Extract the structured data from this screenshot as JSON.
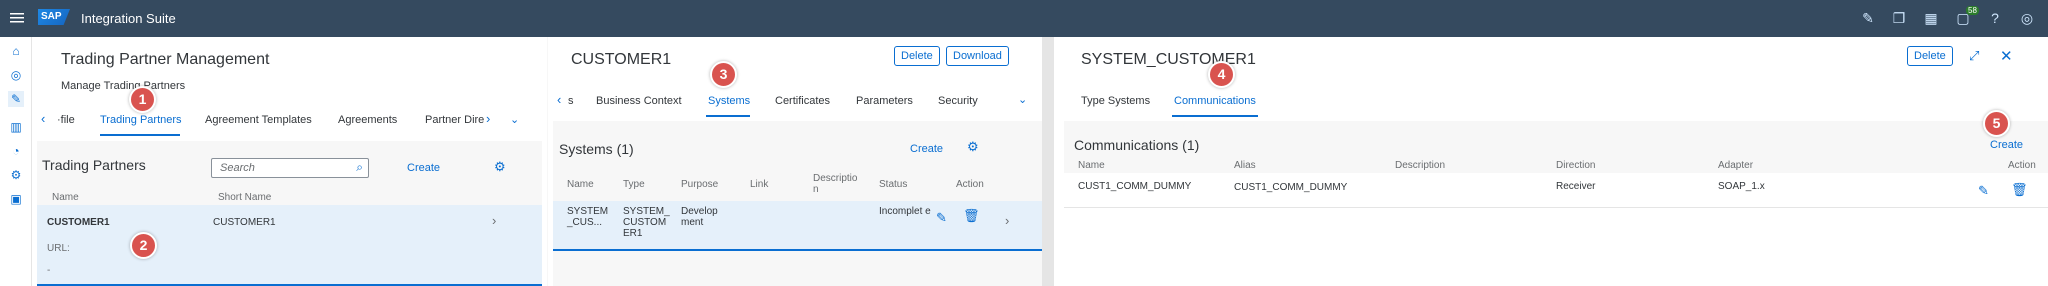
{
  "shell": {
    "logo": "SAP",
    "title": "Integration Suite",
    "notification_count": "58"
  },
  "col1": {
    "title": "Trading Partner Management",
    "subtitle": "Manage Trading Partners",
    "tabs": [
      "·file",
      "Trading Partners",
      "Agreement Templates",
      "Agreements",
      "Partner Dire"
    ],
    "panel_title": "Trading Partners",
    "search_placeholder": "Search",
    "create": "Create",
    "headers": [
      "Name",
      "Short Name"
    ],
    "row": {
      "name": "CUSTOMER1",
      "short": "CUSTOMER1",
      "url_label": "URL:",
      "url_value": "-"
    }
  },
  "col2": {
    "title": "CUSTOMER1",
    "delete": "Delete",
    "download": "Download",
    "tabs": [
      "s",
      "Business Context",
      "Systems",
      "Certificates",
      "Parameters",
      "Security"
    ],
    "panel_title": "Systems (1)",
    "create": "Create",
    "headers": [
      "Name",
      "Type",
      "Purpose",
      "Link",
      "Descriptio n",
      "Status",
      "Action"
    ],
    "row": {
      "name": "SYSTEM _CUS...",
      "type": "SYSTEM_ CUSTOM ER1",
      "purpose": "Develop ment",
      "status": "Incomplet e"
    }
  },
  "col3": {
    "title": "SYSTEM_CUSTOMER1",
    "delete": "Delete",
    "tabs": [
      "Type Systems",
      "Communications"
    ],
    "panel_title": "Communications (1)",
    "create": "Create",
    "headers": [
      "Name",
      "Alias",
      "Description",
      "Direction",
      "Adapter",
      "Action"
    ],
    "row": {
      "name": "CUST1_COMM_DUMMY",
      "alias": "CUST1_COMM_DUMMY",
      "description": "",
      "direction": "Receiver",
      "adapter": "SOAP_1.x"
    }
  },
  "badges": [
    "1",
    "2",
    "3",
    "4",
    "5"
  ],
  "colors": {
    "shell": "#354a5f",
    "accent": "#0a6ed1",
    "badge": "#d9534f"
  }
}
